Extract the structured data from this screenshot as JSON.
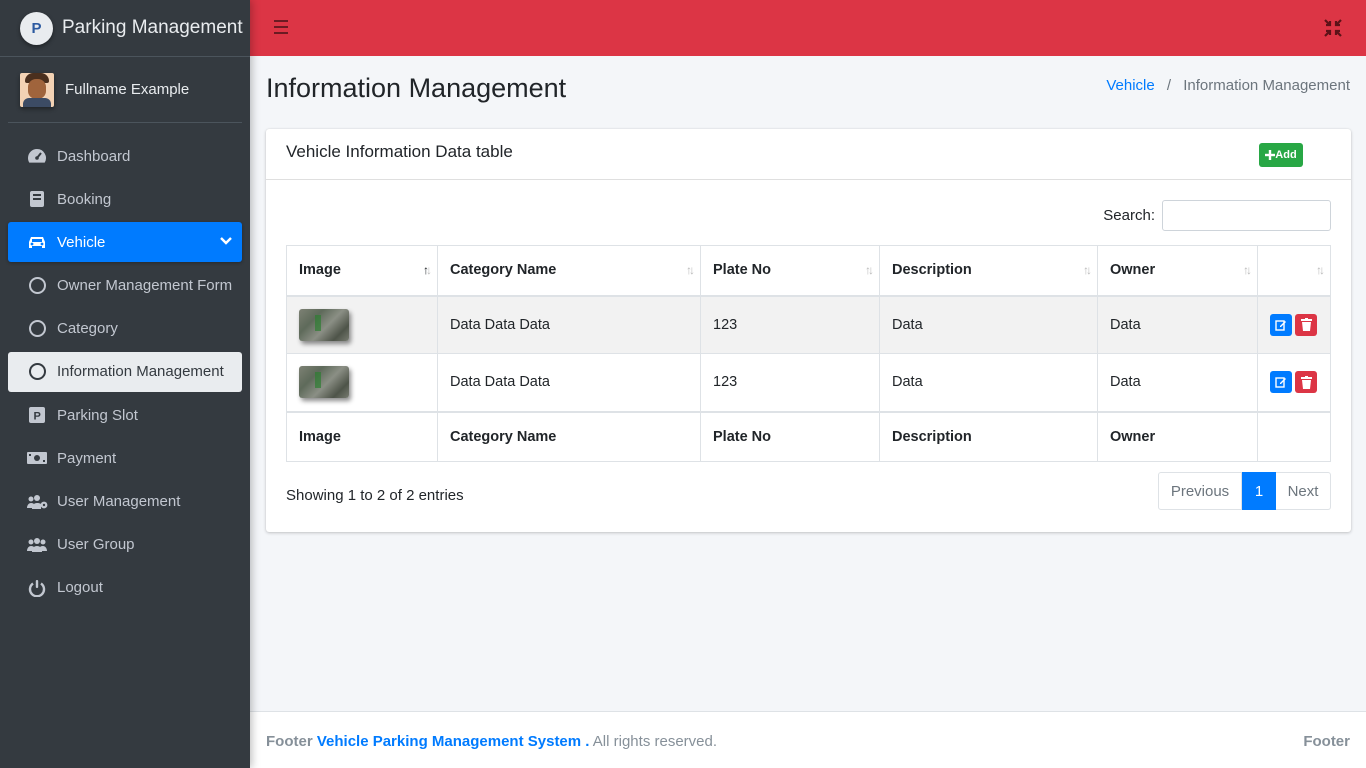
{
  "brand": {
    "title": "Parking Management",
    "logo_text": "P"
  },
  "user": {
    "name": "Fullname Example"
  },
  "sidebar": {
    "items": [
      {
        "label": "Dashboard",
        "icon": "tachometer-icon"
      },
      {
        "label": "Booking",
        "icon": "book-icon"
      },
      {
        "label": "Vehicle",
        "icon": "car-icon"
      },
      {
        "label": "Owner Management Form",
        "icon": "circle-icon"
      },
      {
        "label": "Category",
        "icon": "circle-icon"
      },
      {
        "label": "Information Management",
        "icon": "circle-icon"
      },
      {
        "label": "Parking Slot",
        "icon": "parking-icon"
      },
      {
        "label": "Payment",
        "icon": "money-icon"
      },
      {
        "label": "User Management",
        "icon": "users-cog-icon"
      },
      {
        "label": "User Group",
        "icon": "users-icon"
      },
      {
        "label": "Logout",
        "icon": "power-icon"
      }
    ]
  },
  "page": {
    "title": "Information Management",
    "breadcrumb": {
      "parent": "Vehicle",
      "current": "Information Management",
      "separator": "/"
    }
  },
  "card": {
    "title": "Vehicle Information Data table",
    "add_label": "Add",
    "search_label": "Search:",
    "search_value": ""
  },
  "table": {
    "headers": [
      "Image",
      "Category Name",
      "Plate No",
      "Description",
      "Owner",
      ""
    ],
    "rows": [
      {
        "category": "Data Data Data",
        "plate": "123",
        "description": "Data",
        "owner": "Data"
      },
      {
        "category": "Data Data Data",
        "plate": "123",
        "description": "Data",
        "owner": "Data"
      }
    ],
    "footers": [
      "Image",
      "Category Name",
      "Plate No",
      "Description",
      "Owner",
      ""
    ]
  },
  "pagination": {
    "info": "Showing 1 to 2 of 2 entries",
    "previous": "Previous",
    "current": "1",
    "next": "Next"
  },
  "footer": {
    "prefix": "Footer",
    "system_name": "Vehicle Parking Management System .",
    "suffix": "All rights reserved.",
    "right": "Footer"
  },
  "colors": {
    "header": "#dc3545",
    "sidebar": "#343a40",
    "primary": "#007bff",
    "success": "#28a745",
    "danger": "#dc3545"
  }
}
